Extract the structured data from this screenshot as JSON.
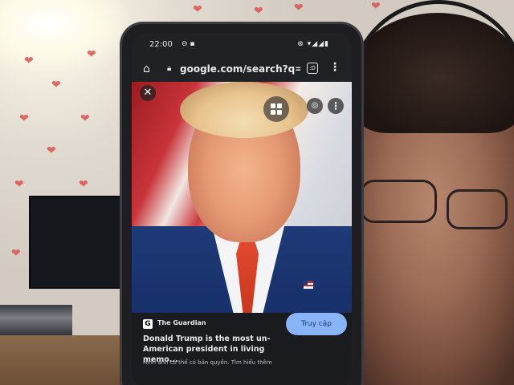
{
  "status_bar": {
    "time": "22:00",
    "notif_icons": "⊖ ▪",
    "right_icons": "⊗ ▾◢◢▮"
  },
  "browser": {
    "url": "google.com/search?q=donal",
    "tab_count": ":D"
  },
  "image_viewer": {
    "source": "The Guardian",
    "title": "Donald Trump is the most un-American president in living memo...",
    "visit_button": "Truy cập",
    "license_note": "Hình ảnh có thể có bản quyền. Tìm hiểu thêm"
  },
  "icons": [
    "home-icon",
    "lock-icon",
    "tabs-icon",
    "menu-icon",
    "close-icon",
    "grid-icon",
    "lens-icon",
    "more-icon"
  ],
  "colors": {
    "accent": "#8ab4f8",
    "dark_bg": "#202124",
    "text": "#e8eaed"
  }
}
